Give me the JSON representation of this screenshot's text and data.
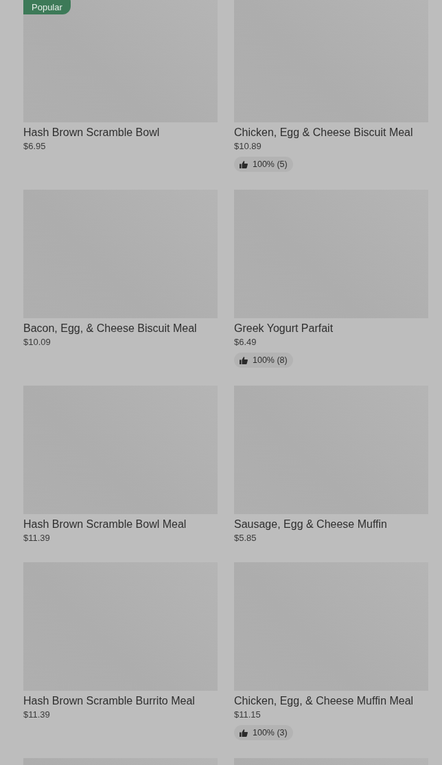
{
  "items": [
    {
      "kind": "item",
      "badge": "Popular",
      "name": "Hash Brown Scramble Bowl",
      "price": "$6.95"
    },
    {
      "kind": "item",
      "name": "Chicken, Egg & Cheese Biscuit Meal",
      "price": "$10.89",
      "rating": "100% (5)"
    },
    {
      "kind": "item",
      "name": "Bacon, Egg, & Cheese Biscuit Meal",
      "price": "$10.09"
    },
    {
      "kind": "item",
      "name": "Greek Yogurt Parfait",
      "price": "$6.49",
      "rating": "100% (8)"
    },
    {
      "kind": "item",
      "name": "Hash Brown Scramble Bowl Meal",
      "price": "$11.39"
    },
    {
      "kind": "item",
      "name": "Sausage, Egg & Cheese Muffin",
      "price": "$5.85"
    },
    {
      "kind": "item",
      "name": "Hash Brown Scramble Burrito Meal",
      "price": "$11.39"
    },
    {
      "kind": "item",
      "name": "Chicken, Egg, & Cheese Muffin Meal",
      "price": "$11.15",
      "rating": "100% (3)"
    },
    {
      "kind": "picture"
    },
    {
      "kind": "picture"
    }
  ]
}
